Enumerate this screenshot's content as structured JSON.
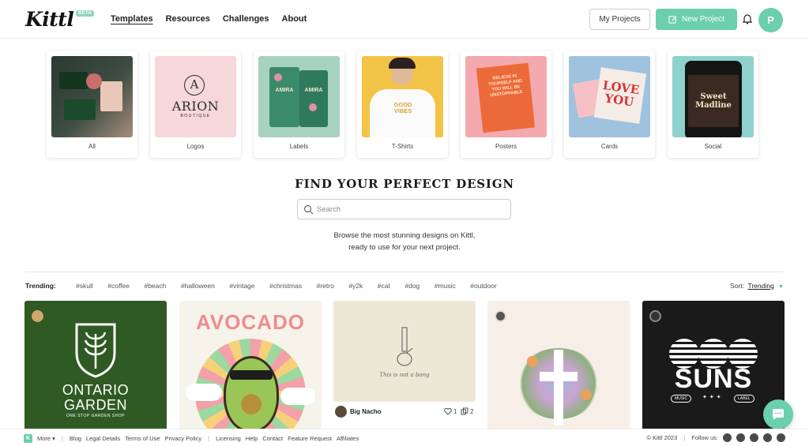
{
  "header": {
    "logo": "Kittl",
    "beta": "BETA",
    "nav": [
      "Templates",
      "Resources",
      "Challenges",
      "About"
    ],
    "my_projects": "My Projects",
    "new_project": "New Project",
    "avatar_initial": "P"
  },
  "categories": [
    {
      "label": "All"
    },
    {
      "label": "Logos",
      "art_title": "ARION",
      "art_sub": "BOUTIQUE",
      "art_letter": "A"
    },
    {
      "label": "Labels",
      "art_text": "AMIRA"
    },
    {
      "label": "T-Shirts",
      "art_text": "GOOD VIBES"
    },
    {
      "label": "Posters",
      "art_text": "BELIEVE IN YOURSELF AND YOU WILL BE UNSTOPPABLE"
    },
    {
      "label": "Cards",
      "art_text": "LOVE YOU"
    },
    {
      "label": "Social",
      "art_title": "Sweet Madline"
    }
  ],
  "hero": {
    "title": "FIND YOUR PERFECT DESIGN",
    "search_placeholder": "Search",
    "subtitle_line1": "Browse the most stunning designs on Kittl,",
    "subtitle_line2": "ready to use for your next project."
  },
  "trending": {
    "label": "Trending:",
    "tags": [
      "#skull",
      "#coffee",
      "#beach",
      "#halloween",
      "#vintage",
      "#christmas",
      "#retro",
      "#y2k",
      "#cat",
      "#dog",
      "#music",
      "#outdoor"
    ],
    "sort_label": "Sort:",
    "sort_value": "Trending"
  },
  "cards": [
    {
      "title": "ONTARIO",
      "title2": "GARDEN",
      "caption": "ONE STOP GARDEN SHOP"
    },
    {
      "title": "AVOCADO"
    },
    {
      "caption": "This is not a bong",
      "author": "Big Nacho",
      "likes": "1",
      "copies": "2"
    },
    {},
    {
      "title": "SUNS",
      "tag_left": "MUSIC",
      "tag_right": "LABEL"
    }
  ],
  "footer": {
    "more": "More",
    "links": [
      "Blog",
      "Legal Details",
      "Terms of Use",
      "Privacy Policy",
      "Licensing",
      "Help",
      "Contact",
      "Feature Request",
      "Affiliates"
    ],
    "copyright": "© Kittl 2023",
    "follow": "Follow us:"
  },
  "colors": {
    "accent": "#6ccfae",
    "ontario_green": "#2e5a22"
  }
}
